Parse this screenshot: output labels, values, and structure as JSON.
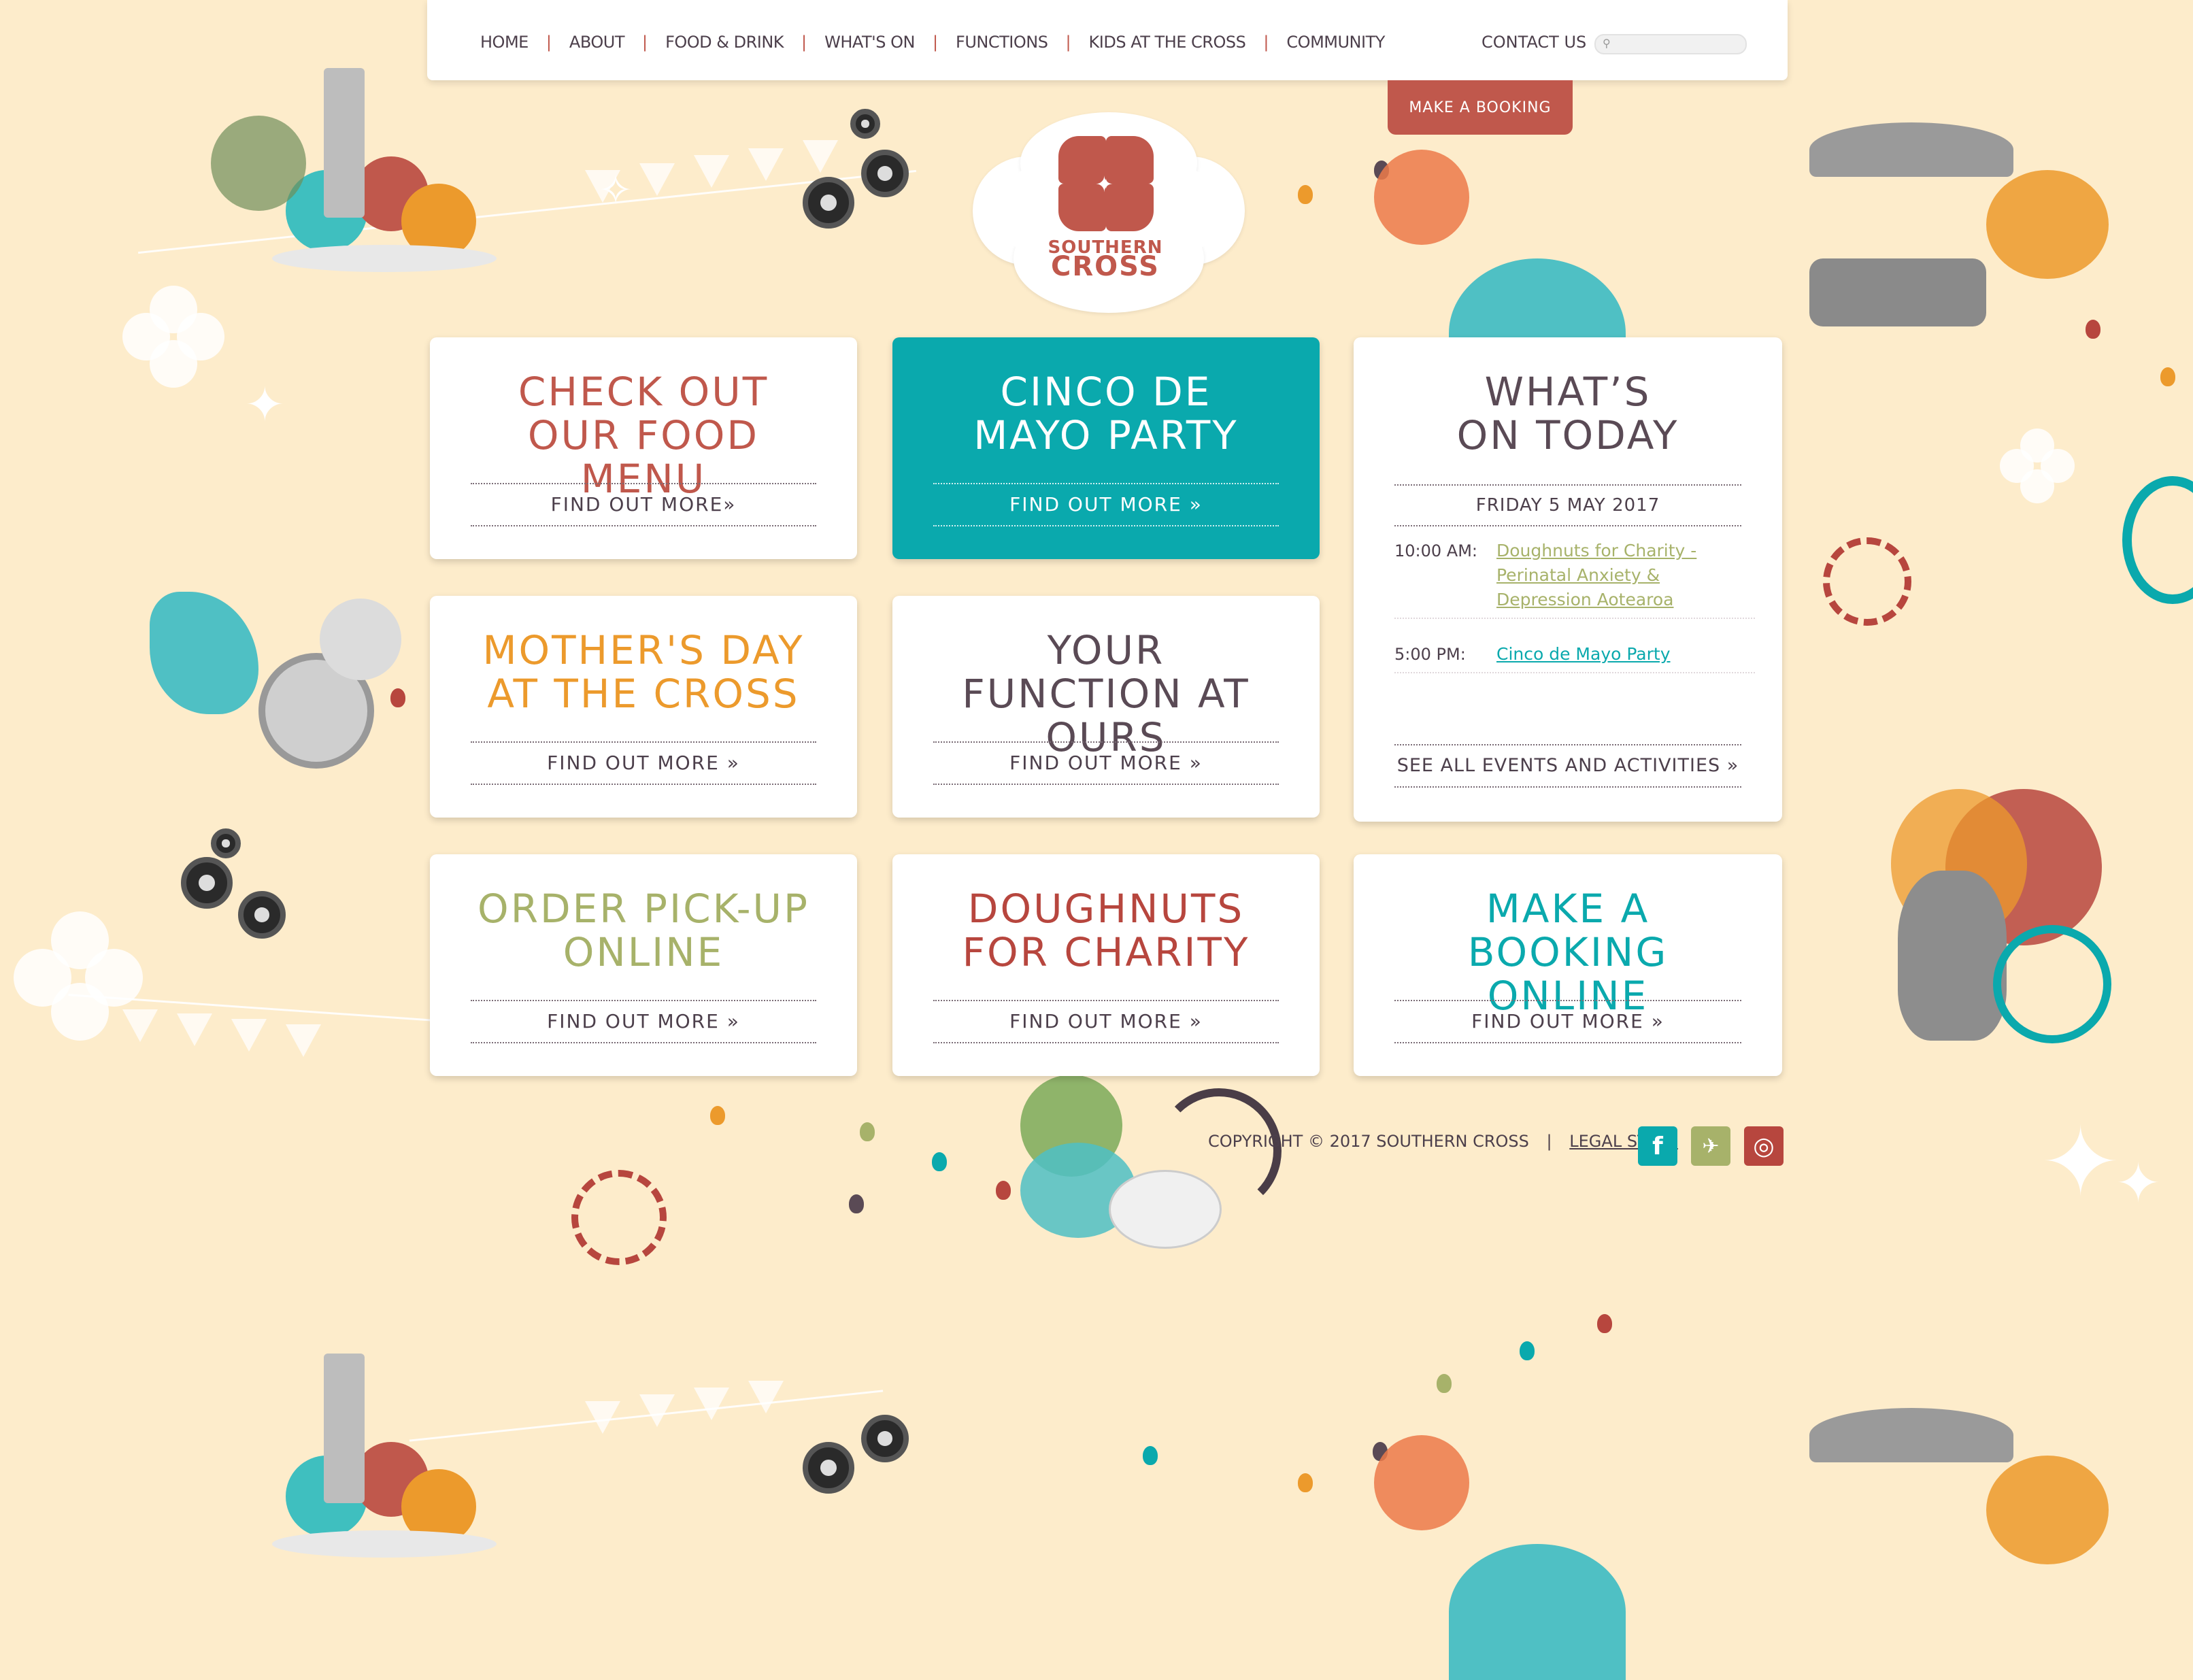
{
  "nav": {
    "items": [
      "HOME",
      "ABOUT",
      "FOOD & DRINK",
      "WHAT'S ON",
      "FUNCTIONS",
      "KIDS AT THE CROSS",
      "COMMUNITY"
    ],
    "contact": "CONTACT US",
    "search_icon": "search-icon"
  },
  "booking_tab": "MAKE A BOOKING",
  "logo": {
    "line1": "SOUTHERN",
    "line2": "CROSS"
  },
  "cards": {
    "food_menu": {
      "title": "CHECK OUT OUR FOOD MENU",
      "link": "FIND OUT MORE»",
      "color": "#c0584c"
    },
    "cinco": {
      "title": "CINCO DE MAYO PARTY",
      "link": "FIND OUT MORE »",
      "color": "#ffffff"
    },
    "mothers_day": {
      "title": "MOTHER'S DAY AT THE CROSS",
      "link": "FIND OUT MORE »",
      "color": "#ec9a2c"
    },
    "function": {
      "title": "YOUR FUNCTION AT OURS",
      "link": "FIND OUT MORE »",
      "color": "#5a4a55"
    },
    "pickup": {
      "title": "ORDER PICK-UP ONLINE",
      "link": "FIND OUT MORE »",
      "color": "#a7b26a"
    },
    "doughnuts": {
      "title": "DOUGHNUTS FOR CHARITY",
      "link": "FIND OUT MORE »",
      "color": "#b7463e"
    },
    "booking": {
      "title": "MAKE A BOOKING ONLINE",
      "link": "FIND OUT MORE »",
      "color": "#0aa9ad"
    }
  },
  "whats_on": {
    "title": "WHAT’S ON TODAY",
    "date": "FRIDAY 5 MAY 2017",
    "events": [
      {
        "time": "10:00 AM:",
        "name": "Doughnuts for Charity - Perinatal Anxiety & Depression Aotearoa",
        "color": "#a7b26a"
      },
      {
        "time": "5:00 PM:",
        "name": "Cinco de Mayo Party",
        "color": "#0aa9ad"
      }
    ],
    "see_all": "SEE ALL EVENTS AND ACTIVITIES »"
  },
  "footer": {
    "copyright": "COPYRIGHT © 2017 SOUTHERN CROSS",
    "separator": "|",
    "legal": "LEGAL STUFF",
    "social": [
      {
        "icon": "facebook-icon",
        "glyph": "f",
        "color": "#0aa9ad"
      },
      {
        "icon": "twitter-icon",
        "glyph": "t",
        "color": "#a7b26a"
      },
      {
        "icon": "instagram-icon",
        "glyph": "◎",
        "color": "#b7463e"
      }
    ]
  },
  "colors": {
    "background": "#fdeccb",
    "accent_red": "#c0584c",
    "teal": "#0aa9ad",
    "olive": "#a7b26a",
    "orange": "#ec9a2c"
  }
}
